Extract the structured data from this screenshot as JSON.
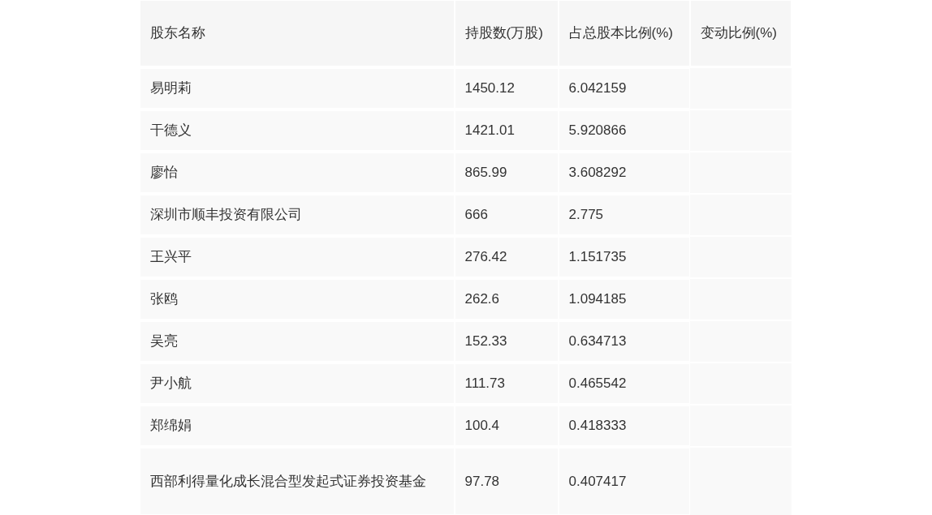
{
  "table": {
    "columns": [
      "股东名称",
      "持股数(万股)",
      "占总股本比例(%)",
      "变动比例(%)"
    ],
    "rows": [
      {
        "cells": [
          "易明莉",
          "1450.12",
          "6.042159"
        ]
      },
      {
        "cells": [
          "干德义",
          "1421.01",
          "5.920866"
        ]
      },
      {
        "cells": [
          "廖怡",
          "865.99",
          "3.608292"
        ]
      },
      {
        "cells": [
          "深圳市顺丰投资有限公司",
          "666",
          "2.775"
        ]
      },
      {
        "cells": [
          "王兴平",
          "276.42",
          "1.151735"
        ]
      },
      {
        "cells": [
          "张鸥",
          "262.6",
          "1.094185"
        ]
      },
      {
        "cells": [
          "吴亮",
          "152.33",
          "0.634713"
        ]
      },
      {
        "cells": [
          "尹小航",
          "111.73",
          "0.465542"
        ]
      },
      {
        "cells": [
          "郑绵娟",
          "100.4",
          "0.418333"
        ]
      },
      {
        "cells": [
          "西部利得量化成长混合型发起式证券投资基金",
          "97.78",
          "0.407417"
        ]
      }
    ]
  }
}
